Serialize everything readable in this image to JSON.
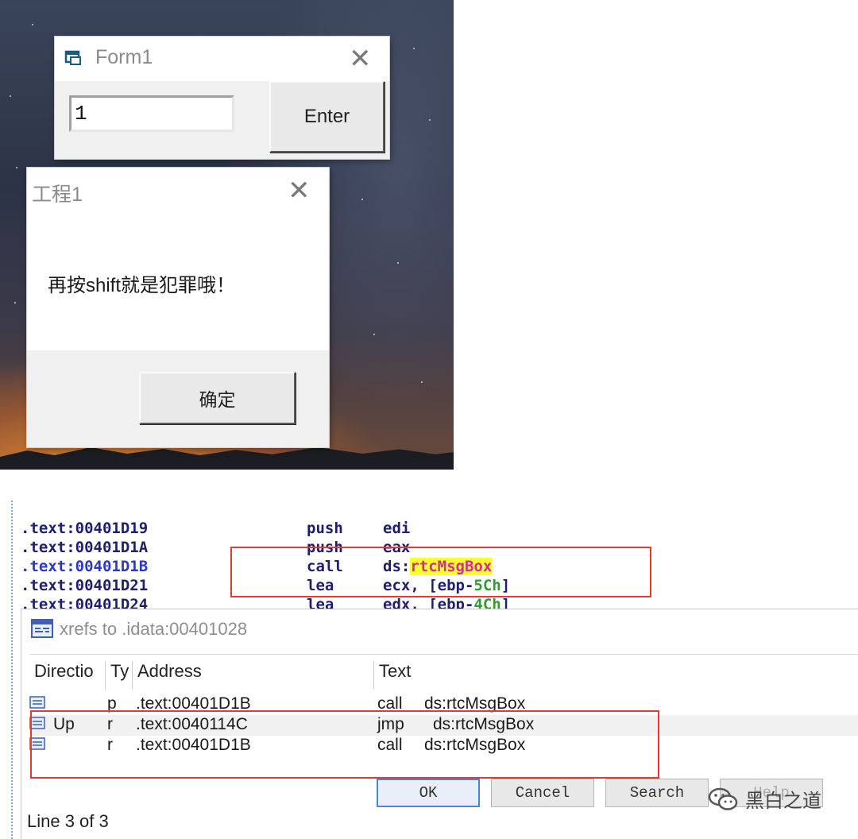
{
  "form1": {
    "title": "Form1",
    "input_value": "1",
    "enter_label": "Enter",
    "close_glyph": "✕"
  },
  "msgbox": {
    "title": "工程1",
    "message": "再按shift就是犯罪哦！",
    "ok_label": "确定",
    "close_glyph": "✕"
  },
  "disasm": {
    "lines": [
      {
        "addr": ".text:00401D19",
        "mnem": "push",
        "opnd": "edi"
      },
      {
        "addr": ".text:00401D1A",
        "mnem": "push",
        "opnd": "eax"
      },
      {
        "addr": ".text:00401D1B",
        "mnem": "call",
        "opnd_prefix": "ds:",
        "opnd_sym": "rtcMsgBox"
      },
      {
        "addr": ".text:00401D21",
        "mnem": "lea",
        "opnd_prefix": "ecx, [ebp-",
        "opnd_num": "5Ch",
        "opnd_suffix": "]"
      },
      {
        "addr": ".text:00401D24",
        "mnem": "lea",
        "opnd_prefix": "edx, [ebp-",
        "opnd_num": "4Ch",
        "opnd_suffix": "]"
      }
    ]
  },
  "xrefs": {
    "title": "xrefs to .idata:00401028",
    "columns": [
      "Directio",
      "Ty",
      "Address",
      "Text"
    ],
    "rows": [
      {
        "direction": "",
        "type": "p",
        "address": ".text:00401D1B",
        "text_mnem": "call",
        "text_op": "ds:rtcMsgBox"
      },
      {
        "direction": "Up",
        "type": "r",
        "address": ".text:0040114C",
        "text_mnem": "jmp",
        "text_op": "ds:rtcMsgBox"
      },
      {
        "direction": "",
        "type": "r",
        "address": ".text:00401D1B",
        "text_mnem": "call",
        "text_op": "ds:rtcMsgBox"
      }
    ],
    "buttons": {
      "ok": "OK",
      "cancel": "Cancel",
      "search": "Search",
      "help": "Help"
    },
    "status": "Line 3 of 3"
  },
  "watermark": {
    "text": "黑白之道"
  },
  "colors": {
    "highlight": "#e53935",
    "symbol_bg": "#ffff30",
    "symbol_fg": "#d42c9a",
    "number": "#2f9c2f"
  }
}
